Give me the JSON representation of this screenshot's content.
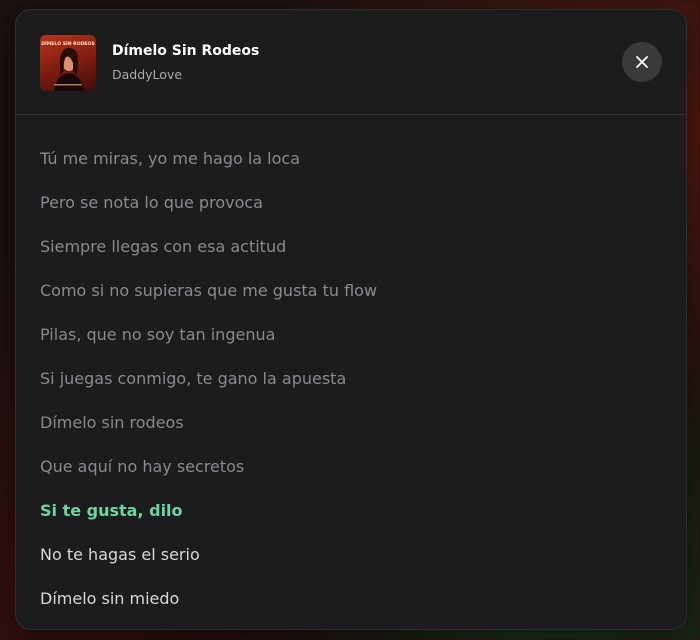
{
  "track": {
    "title": "Dímelo Sin Rodeos",
    "artist": "DaddyLove",
    "cover_text": "DÍMELO SIN RODEOS"
  },
  "controls": {
    "close_icon": "close-icon"
  },
  "lyrics": {
    "lines": [
      {
        "text": "Tú me miras, yo me hago la loca",
        "state": "past"
      },
      {
        "text": "Pero se nota lo que provoca",
        "state": "past"
      },
      {
        "text": "Siempre llegas con esa actitud",
        "state": "past"
      },
      {
        "text": "Como si no supieras que me gusta tu flow",
        "state": "past"
      },
      {
        "text": "Pilas, que no soy tan ingenua",
        "state": "past"
      },
      {
        "text": "Si juegas conmigo, te gano la apuesta",
        "state": "past"
      },
      {
        "text": "Dímelo sin rodeos",
        "state": "past"
      },
      {
        "text": "Que aquí no hay secretos",
        "state": "past"
      },
      {
        "text": "Si te gusta, dilo",
        "state": "active"
      },
      {
        "text": "No te hagas el serio",
        "state": "upcoming"
      },
      {
        "text": "Dímelo sin miedo",
        "state": "upcoming"
      }
    ]
  },
  "colors": {
    "active_line": "#6fd4a0",
    "past_line": "#8a8a8f",
    "upcoming_line": "#d8d8dc",
    "modal_bg": "#1c1c1e"
  }
}
